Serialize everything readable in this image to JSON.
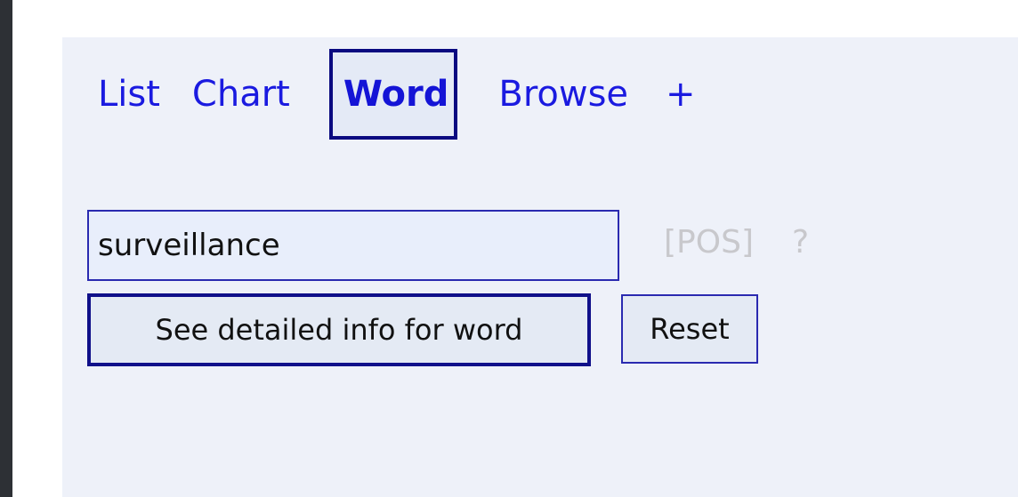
{
  "nav": {
    "tabs": [
      {
        "label": "List"
      },
      {
        "label": "Chart"
      },
      {
        "label": "Word",
        "active": true
      },
      {
        "label": "Browse"
      },
      {
        "label": "+"
      }
    ]
  },
  "search": {
    "value": "surveillance",
    "placeholder": ""
  },
  "pos": {
    "label": "[POS]",
    "help": "?"
  },
  "buttons": {
    "detail_label": "See detailed info for word",
    "reset_label": "Reset"
  },
  "colors": {
    "link": "#1a1ae0",
    "active_border": "#0a0a80",
    "panel_bg": "#eef1f9",
    "page_bg": "#2d3035",
    "muted": "#c8c8cc"
  }
}
